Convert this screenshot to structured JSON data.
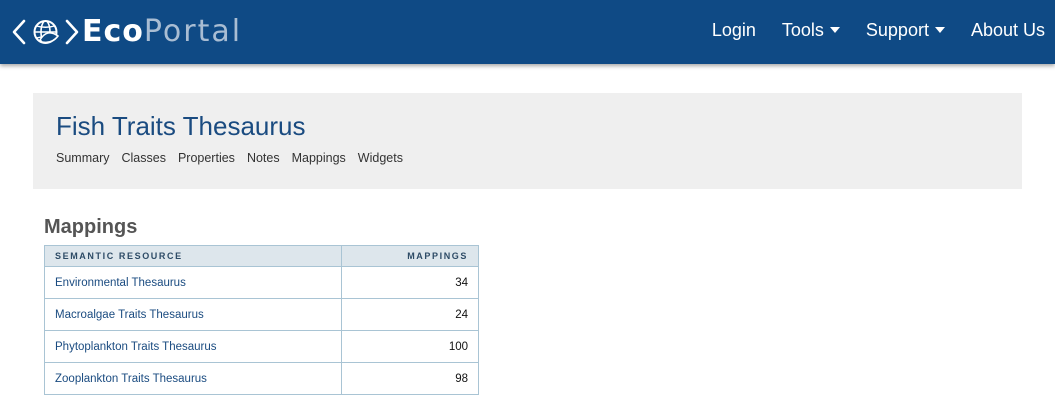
{
  "navbar": {
    "brand_eco": "Eco",
    "brand_portal": "Portal",
    "items": [
      {
        "label": "Login",
        "has_dropdown": false
      },
      {
        "label": "Tools",
        "has_dropdown": true
      },
      {
        "label": "Support",
        "has_dropdown": true
      },
      {
        "label": "About Us",
        "has_dropdown": false
      }
    ]
  },
  "header": {
    "title": "Fish Traits Thesaurus",
    "tabs": [
      "Summary",
      "Classes",
      "Properties",
      "Notes",
      "Mappings",
      "Widgets"
    ]
  },
  "mappings": {
    "section_title": "Mappings",
    "columns": [
      "SEMANTIC RESOURCE",
      "MAPPINGS"
    ],
    "rows": [
      {
        "resource": "Environmental Thesaurus",
        "count": "34"
      },
      {
        "resource": "Macroalgae Traits Thesaurus",
        "count": "24"
      },
      {
        "resource": "Phytoplankton Traits Thesaurus",
        "count": "100"
      },
      {
        "resource": "Zooplankton Traits Thesaurus",
        "count": "98"
      }
    ]
  },
  "colors": {
    "navbar_bg": "#0f4a85",
    "title": "#1a4b80",
    "panel_bg": "#efefef",
    "table_header_bg": "#dde6ec"
  },
  "icons": {
    "logo": "globe-brackets-icon",
    "dropdown": "caret-down-icon"
  }
}
